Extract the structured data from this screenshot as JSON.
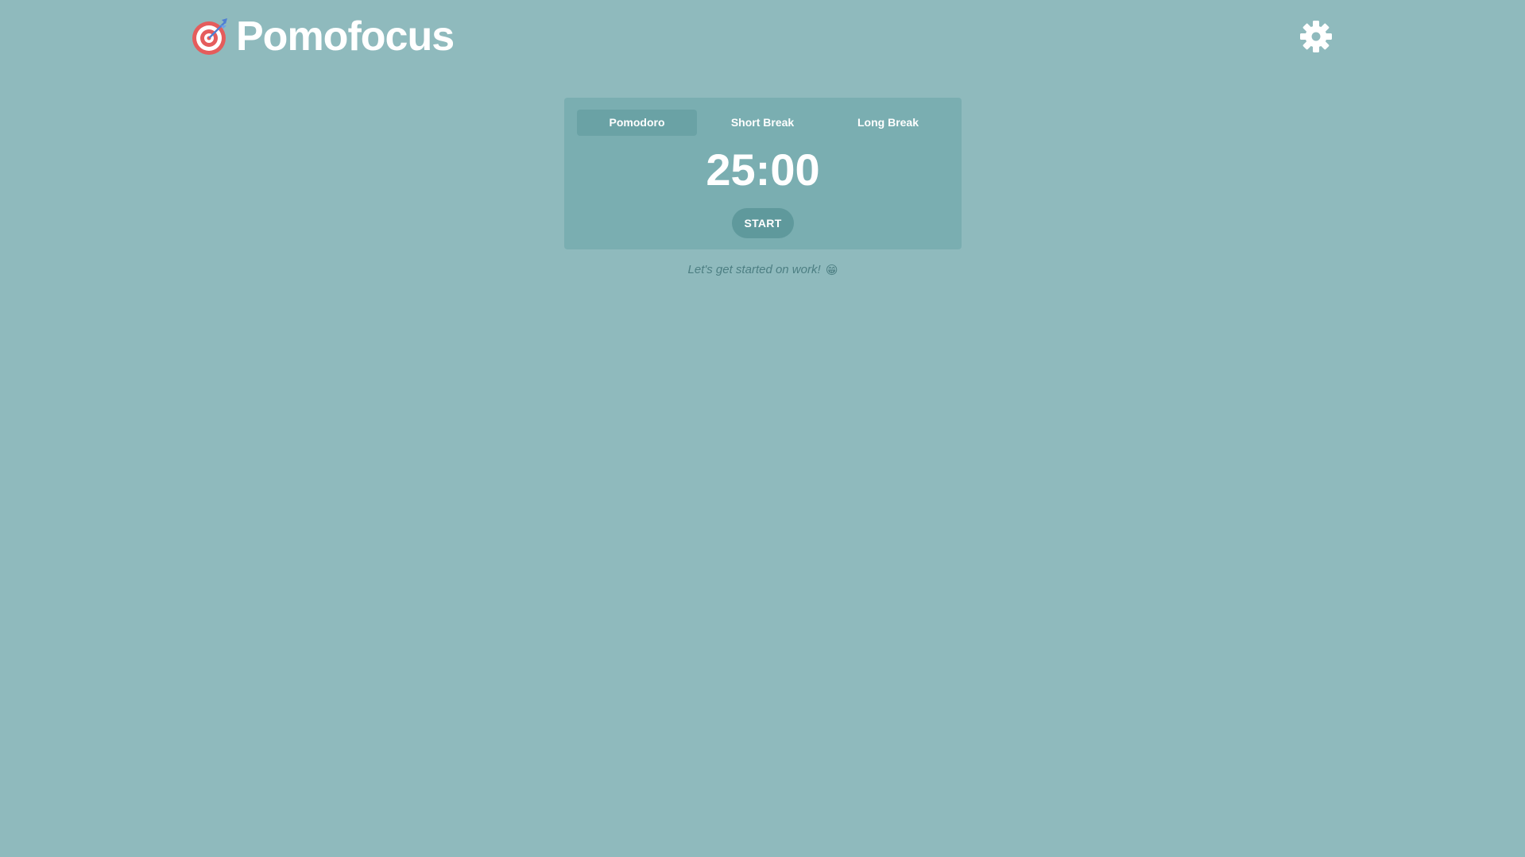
{
  "app": {
    "title": "Pomofocus",
    "logo_icon": "target-icon",
    "settings_icon": "gear-icon"
  },
  "colors": {
    "background": "#8fbabd",
    "card": "#7aaeb1",
    "active_tab": "#6aa2a5",
    "button": "#5f999c",
    "text": "#ffffff",
    "message_text": "#4d7f83",
    "logo_red": "#e55c5c"
  },
  "timer": {
    "tabs": [
      {
        "label": "Pomodoro",
        "active": true
      },
      {
        "label": "Short Break",
        "active": false
      },
      {
        "label": "Long Break",
        "active": false
      }
    ],
    "time": "25:00",
    "start_label": "START"
  },
  "message": {
    "text": "Let's get started on work!",
    "emoji": "😁"
  }
}
